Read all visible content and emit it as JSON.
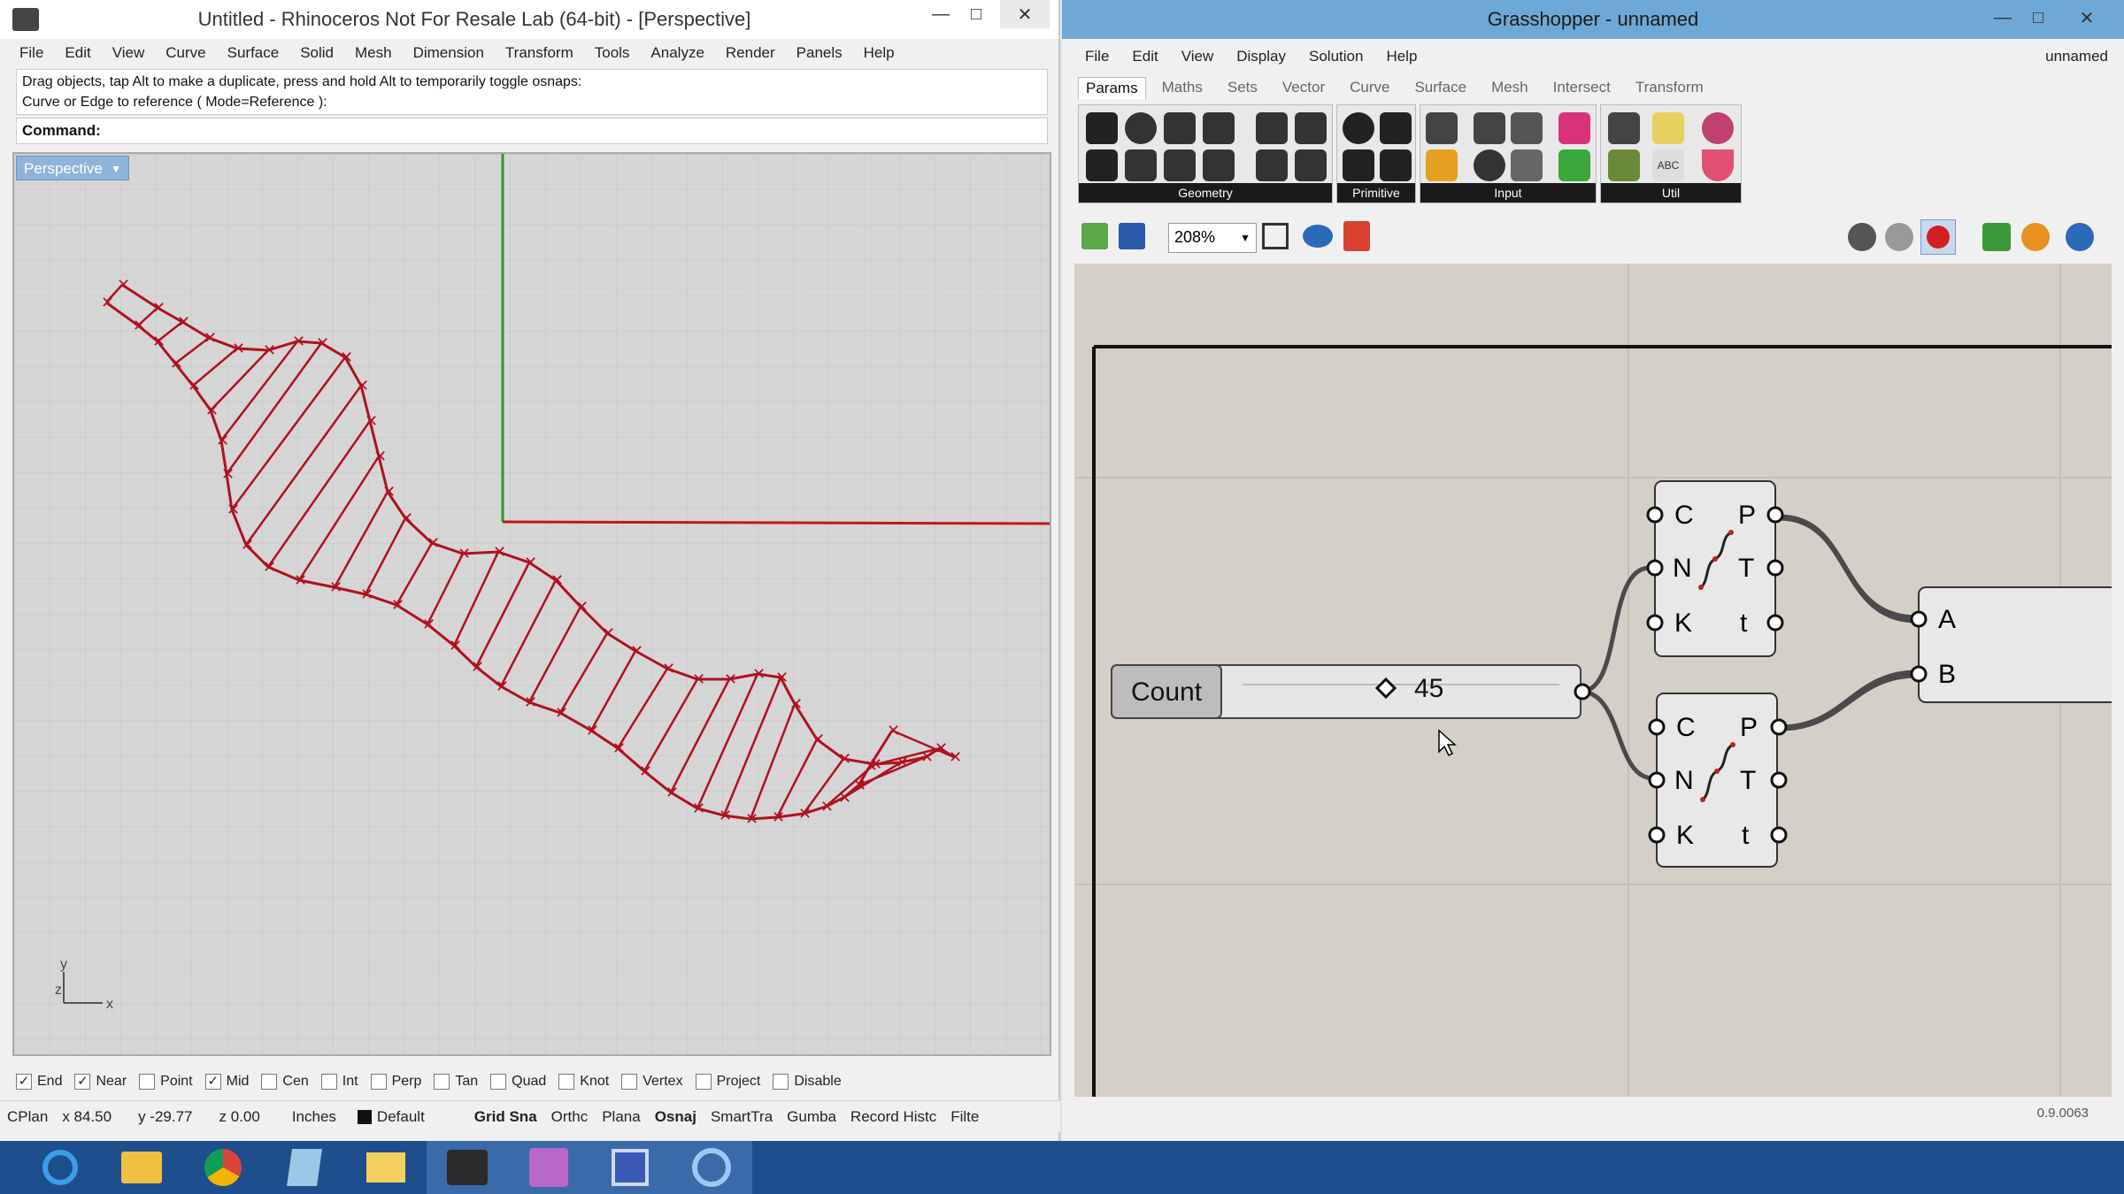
{
  "rhino": {
    "title": "Untitled - Rhinoceros Not For Resale Lab (64-bit) - [Perspective]",
    "menu": [
      "File",
      "Edit",
      "View",
      "Curve",
      "Surface",
      "Solid",
      "Mesh",
      "Dimension",
      "Transform",
      "Tools",
      "Analyze",
      "Render",
      "Panels",
      "Help"
    ],
    "history_line1": "Drag objects, tap Alt to make a duplicate, press and hold Alt to temporarily toggle osnaps:",
    "history_line2": "Curve or Edge to reference ( Mode=Reference ):",
    "command_label": "Command:",
    "viewport_label": "Perspective",
    "axis_y": "y",
    "axis_z": "z",
    "axis_x": "x",
    "osnaps": [
      {
        "label": "End",
        "checked": true
      },
      {
        "label": "Near",
        "checked": true
      },
      {
        "label": "Point",
        "checked": false
      },
      {
        "label": "Mid",
        "checked": true
      },
      {
        "label": "Cen",
        "checked": false
      },
      {
        "label": "Int",
        "checked": false
      },
      {
        "label": "Perp",
        "checked": false
      },
      {
        "label": "Tan",
        "checked": false
      },
      {
        "label": "Quad",
        "checked": false
      },
      {
        "label": "Knot",
        "checked": false
      },
      {
        "label": "Vertex",
        "checked": false
      },
      {
        "label": "Project",
        "checked": false
      },
      {
        "label": "Disable",
        "checked": false
      }
    ],
    "status": {
      "cplane": "CPlan",
      "x": "x 84.50",
      "y": "y -29.77",
      "z": "z 0.00",
      "units": "Inches",
      "layer": "Default",
      "toggles": [
        "Grid Sna",
        "Orthc",
        "Plana",
        "Osnaj",
        "SmartTra",
        "Gumba",
        "Record Histc",
        "Filte"
      ]
    },
    "colors": {
      "curve": "#b01020",
      "axis_green": "#2a9a2a",
      "axis_red": "#c01818"
    }
  },
  "gh": {
    "title": "Grasshopper - unnamed",
    "doc_name": "unnamed",
    "menu": [
      "File",
      "Edit",
      "View",
      "Display",
      "Solution",
      "Help"
    ],
    "tabs": [
      "Params",
      "Maths",
      "Sets",
      "Vector",
      "Curve",
      "Surface",
      "Mesh",
      "Intersect",
      "Transform"
    ],
    "ribbon_groups": [
      "Geometry",
      "Primitive",
      "Input",
      "Util"
    ],
    "zoom": "208%",
    "slider": {
      "name": "Count",
      "value": "45"
    },
    "comp1": {
      "inputs": [
        "C",
        "N",
        "K"
      ],
      "outputs": [
        "P",
        "T",
        "t"
      ]
    },
    "comp2": {
      "inputs": [
        "C",
        "N",
        "K"
      ],
      "outputs": [
        "P",
        "T",
        "t"
      ]
    },
    "comp3": {
      "inputs": [
        "A",
        "B"
      ]
    },
    "version": "0.9.0063"
  },
  "taskbar": [
    "ie-icon",
    "explorer-icon",
    "chrome-icon",
    "app-icon",
    "folder-icon",
    "rhino-icon",
    "paint-icon",
    "floppy-icon",
    "grasshopper-icon"
  ]
}
